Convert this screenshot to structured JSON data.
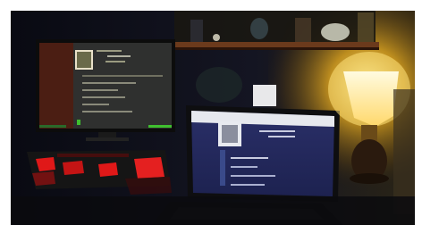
{
  "scene": {
    "description_tag": "dark-desk-setup",
    "palette": {
      "frame": "#ffffff",
      "room": "#0d0e16",
      "shelf": "#5a2e16",
      "monitor_screen": "#2e2f2e",
      "monitor_left_panel": "#4a1c12",
      "laptop_screen": "#24285a",
      "laptop_header": "#e6e8ee",
      "lamp_glow": "#ffd23a",
      "lamp_shade": "#fff6c8",
      "keyboard_red": "#e01818",
      "accent_green": "#3fbf2f"
    },
    "icons": [
      "monitor-icon",
      "laptop-icon",
      "lamp-icon",
      "keyboard-icon",
      "shelf-icon"
    ]
  }
}
